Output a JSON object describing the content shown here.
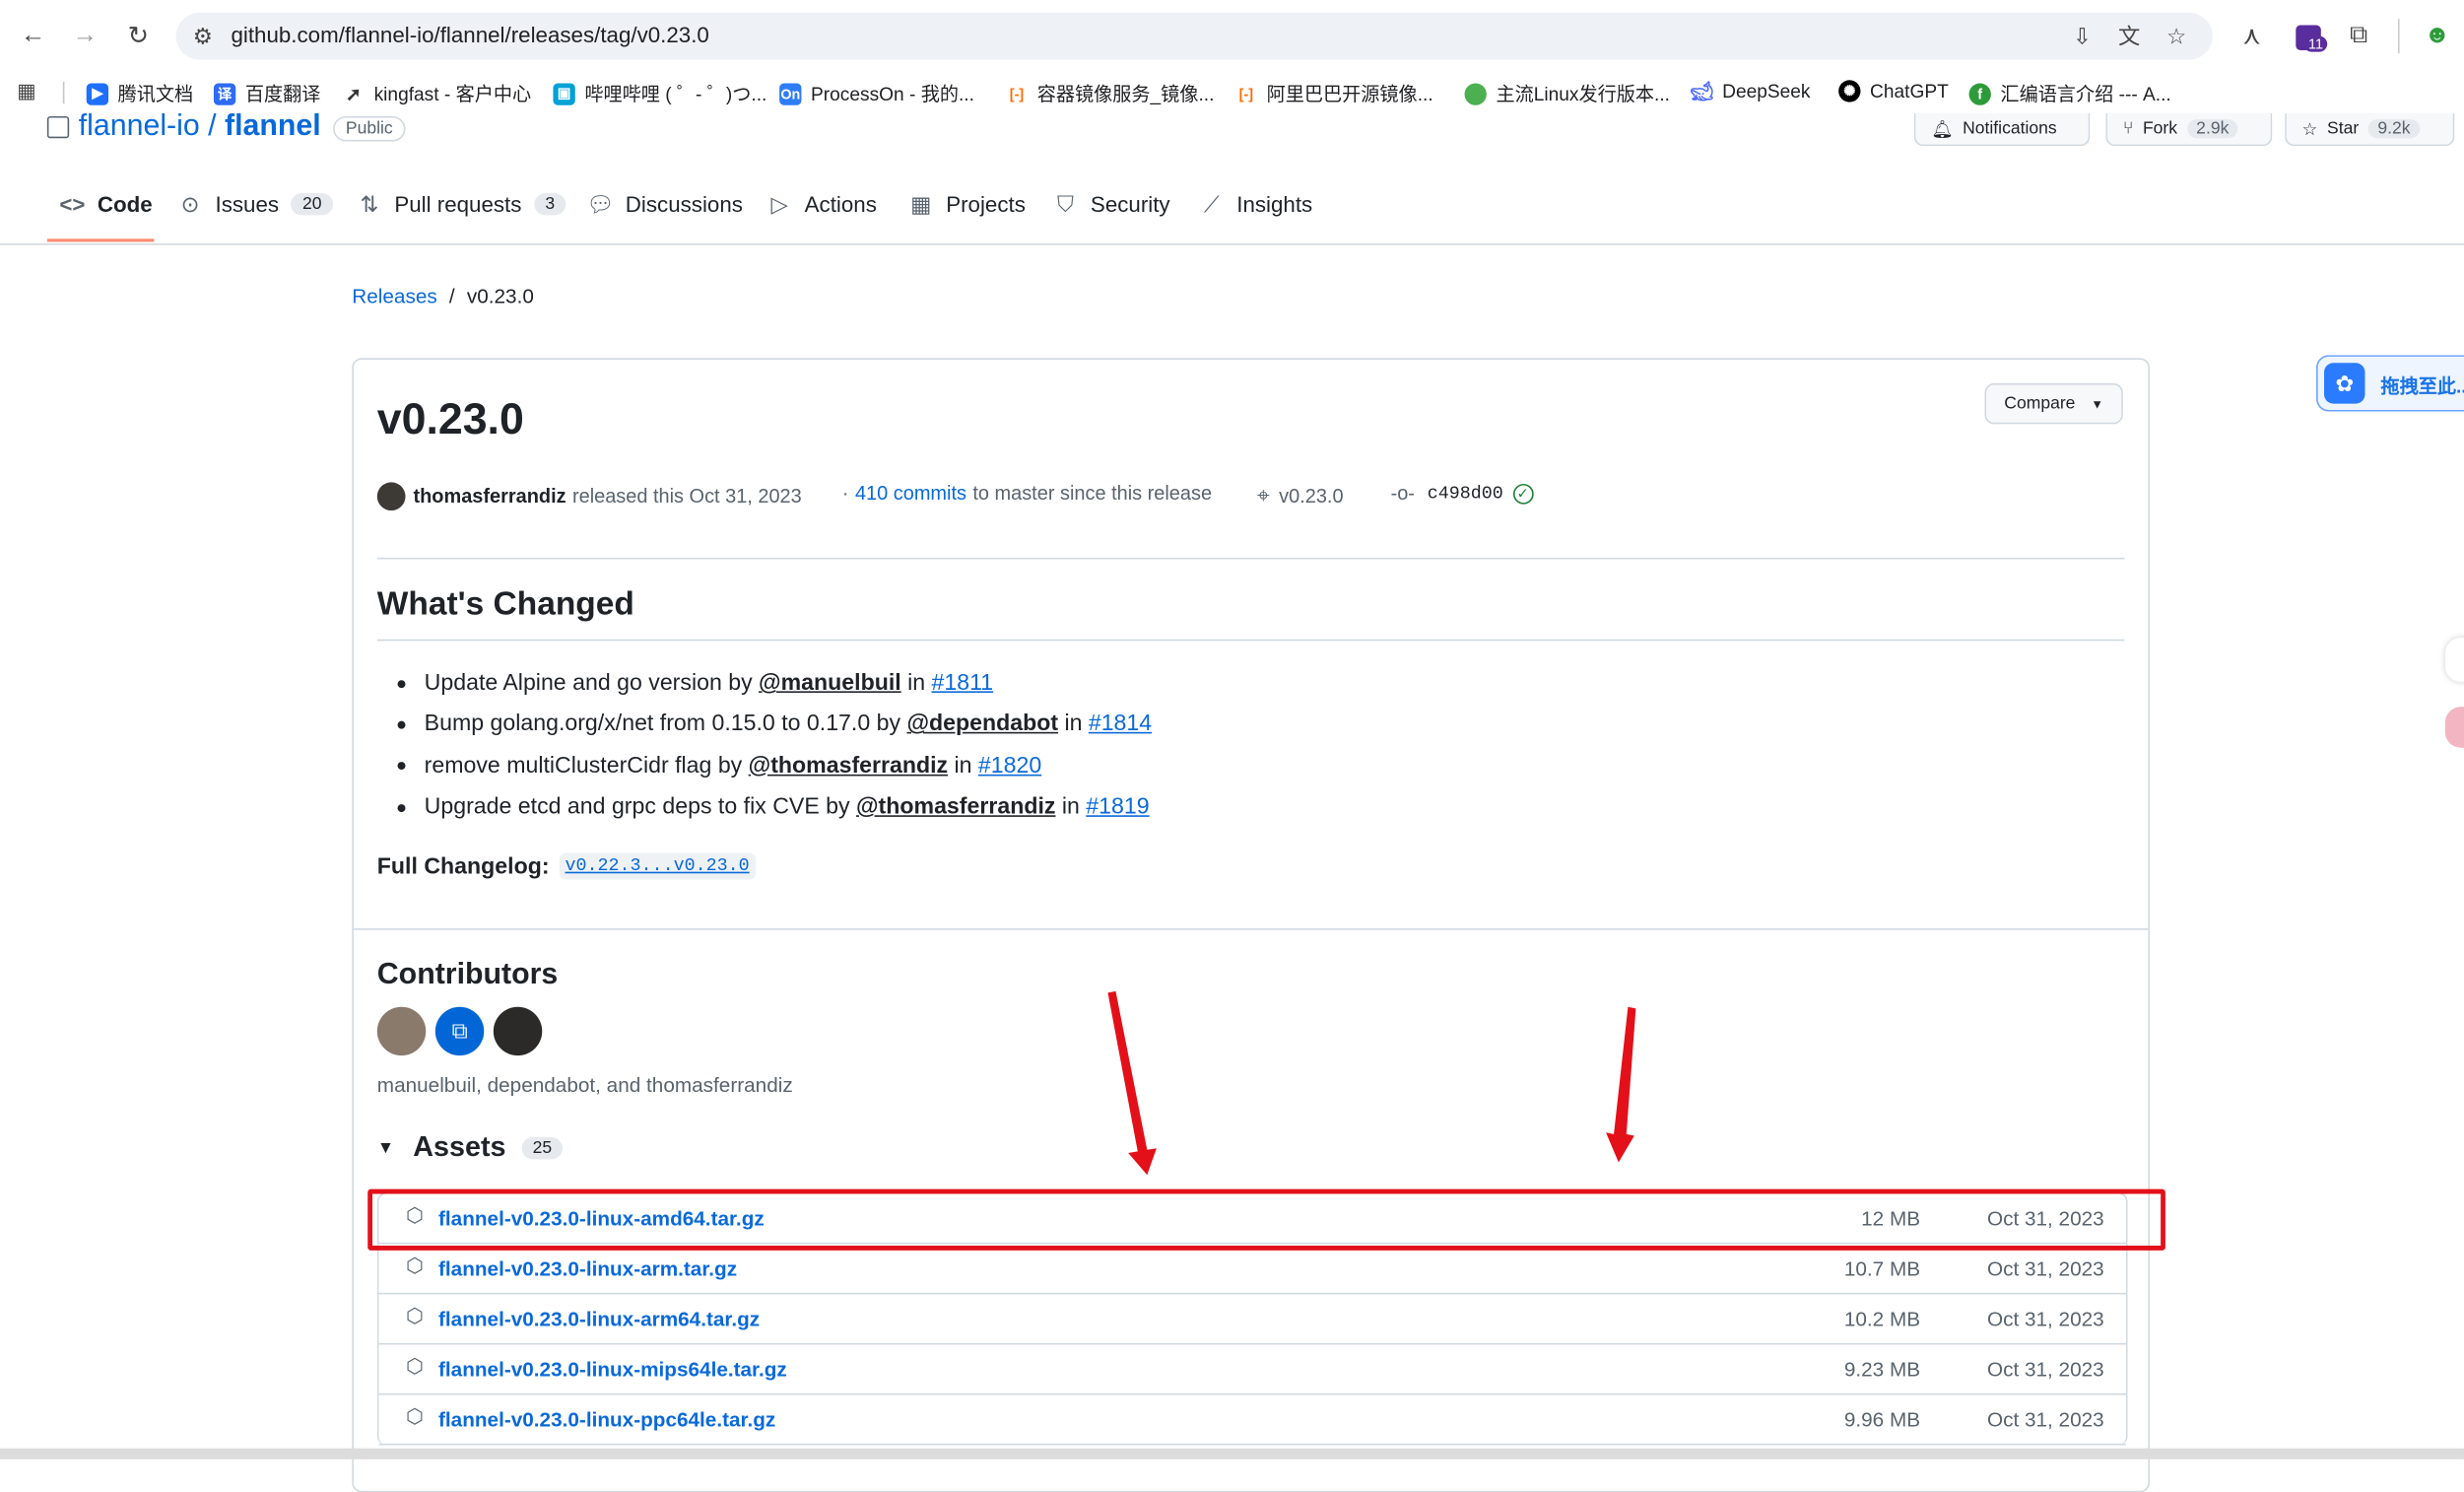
{
  "browser": {
    "url": "github.com/flannel-io/flannel/releases/tag/v0.23.0",
    "bookmarks": [
      {
        "label": "腾讯文档",
        "color": "#1e6fff"
      },
      {
        "label": "百度翻译",
        "color": "#2f6cf5"
      },
      {
        "label": "kingfast - 客户中心",
        "color": "#333333"
      },
      {
        "label": "哔哩哔哩 ( ゜- ゜)つ...",
        "color": "#00a1d6"
      },
      {
        "label": "ProcessOn - 我的...",
        "color": "#2e7df6"
      },
      {
        "label": "容器镜像服务_镜像...",
        "color": "#ff6a00"
      },
      {
        "label": "阿里巴巴开源镜像...",
        "color": "#ff6a00"
      },
      {
        "label": "主流Linux发行版本...",
        "color": "#4caf50"
      },
      {
        "label": "DeepSeek",
        "color": "#4d6bfe"
      },
      {
        "label": "ChatGPT",
        "color": "#000000"
      },
      {
        "label": "汇编语言介绍 --- A...",
        "color": "#2e9b3a"
      }
    ],
    "extension_badge": "11"
  },
  "repo": {
    "owner": "flannel-io",
    "name": "flannel",
    "visibility": "Public",
    "notifications_label": "Notifications",
    "fork_label": "Fork",
    "fork_count": "2.9k",
    "star_label": "Star",
    "star_count": "9.2k"
  },
  "tabs": [
    {
      "label": "Code",
      "icon": "code-icon"
    },
    {
      "label": "Issues",
      "count": "20",
      "icon": "issue-icon"
    },
    {
      "label": "Pull requests",
      "count": "3",
      "icon": "pull-request-icon"
    },
    {
      "label": "Discussions",
      "icon": "discussion-icon"
    },
    {
      "label": "Actions",
      "icon": "play-icon"
    },
    {
      "label": "Projects",
      "icon": "table-icon"
    },
    {
      "label": "Security",
      "icon": "shield-icon"
    },
    {
      "label": "Insights",
      "icon": "graph-icon"
    }
  ],
  "breadcrumb": {
    "root": "Releases",
    "sep": "/",
    "current": "v0.23.0"
  },
  "release": {
    "title": "v0.23.0",
    "compare_label": "Compare",
    "author": "thomasferrandiz",
    "released_text": "released this Oct 31, 2023",
    "commits_prefix": "·",
    "commits_link": "410 commits",
    "commits_suffix": "to master since this release",
    "tag": "v0.23.0",
    "commit": "c498d00",
    "whats_changed_heading": "What's Changed",
    "changes": [
      {
        "text": "Update Alpine and go version by",
        "user": "@manuelbuil",
        "in": "in",
        "pr": "#1811"
      },
      {
        "text": "Bump golang.org/x/net from 0.15.0 to 0.17.0 by",
        "user": "@dependabot",
        "in": "in",
        "pr": "#1814"
      },
      {
        "text": "remove multiClusterCidr flag by",
        "user": "@thomasferrandiz",
        "in": "in",
        "pr": "#1820"
      },
      {
        "text": "Upgrade etcd and grpc deps to fix CVE by",
        "user": "@thomasferrandiz",
        "in": "in",
        "pr": "#1819"
      }
    ],
    "full_changelog_label": "Full Changelog",
    "full_changelog_link": "v0.22.3...v0.23.0",
    "contributors_heading": "Contributors",
    "contributors_names": "manuelbuil, dependabot, and thomasferrandiz",
    "assets_heading": "Assets",
    "assets_count": "25",
    "assets": [
      {
        "name": "flannel-v0.23.0-linux-amd64.tar.gz",
        "size": "12 MB",
        "date": "Oct 31, 2023"
      },
      {
        "name": "flannel-v0.23.0-linux-arm.tar.gz",
        "size": "10.7 MB",
        "date": "Oct 31, 2023"
      },
      {
        "name": "flannel-v0.23.0-linux-arm64.tar.gz",
        "size": "10.2 MB",
        "date": "Oct 31, 2023"
      },
      {
        "name": "flannel-v0.23.0-linux-mips64le.tar.gz",
        "size": "9.23 MB",
        "date": "Oct 31, 2023"
      },
      {
        "name": "flannel-v0.23.0-linux-ppc64le.tar.gz",
        "size": "9.96 MB",
        "date": "Oct 31, 2023"
      }
    ]
  },
  "side_widget": {
    "label": "拖拽至此..."
  },
  "annotation": {
    "highlight_color": "#e3101a",
    "arrow_color": "#e3101a"
  }
}
